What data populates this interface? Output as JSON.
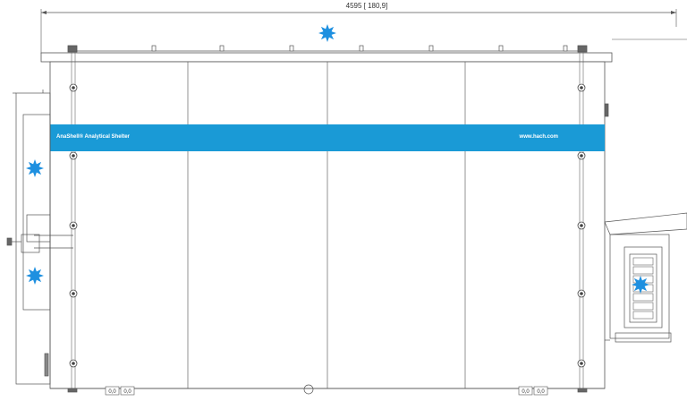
{
  "drawing": {
    "overall_dimension": "4595 [ 180,9]",
    "brand_band": {
      "color": "#1a9ad6",
      "left_text": "AnaShell® Analytical Shelter",
      "right_text": "www.hach.com"
    },
    "bottom_plate_label": "0,0",
    "line_color": "#555555",
    "marker_color": "#1e90e0",
    "marker_icon": "light-icon",
    "marker_count": 5
  }
}
